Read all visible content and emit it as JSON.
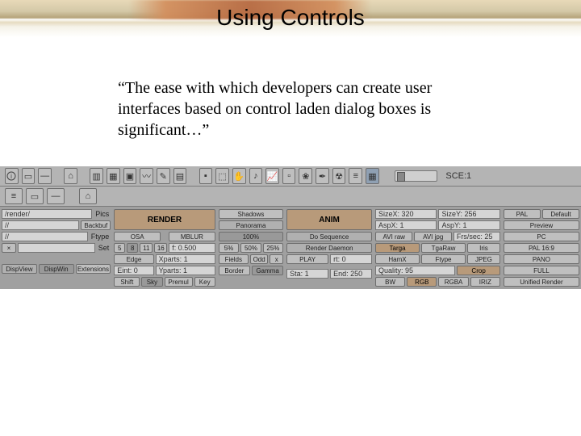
{
  "title": "Using Controls",
  "quote": "“The ease with which developers can create user interfaces based on control laden dialog boxes is significant…”",
  "scene_label": "SCE:1",
  "left_panel": {
    "path_field": "/render/",
    "pics_label": "Pics",
    "backbuf_btn": "Backbuf",
    "ftype_label": "Ftype",
    "set_label": "Set",
    "dispview": "DispView",
    "dispwin": "DispWin",
    "extensions": "Extensions"
  },
  "render_col": {
    "render_btn": "RENDER",
    "osa": "OSA",
    "mblur": "MBLUR",
    "n5": "5",
    "n8": "8",
    "n11": "11",
    "n16": "16",
    "f05": "f: 0.500",
    "edge": "Edge",
    "eint": "Eint: 0",
    "shift": "Shift",
    "sky": "Sky",
    "premul": "Premul",
    "key": "Key",
    "xparts": "Xparts: 1",
    "yparts": "Yparts: 1"
  },
  "mid_col": {
    "shadows": "Shadows",
    "panorama": "Panorama",
    "p100": "100%",
    "p5": "5%",
    "p50": "50%",
    "p25": "25%",
    "fields": "Fields",
    "odd": "Odd",
    "x": "x",
    "border": "Border",
    "gamma": "Gamma"
  },
  "anim_col": {
    "anim_btn": "ANIM",
    "do_seq": "Do Sequence",
    "render_daemon": "Render Daemon",
    "play": "PLAY",
    "rt0": "rt: 0",
    "sta": "Sta: 1",
    "end": "End: 250"
  },
  "size_col": {
    "sizex": "SizeX: 320",
    "sizey": "SizeY: 256",
    "aspx": "AspX: 1",
    "aspy": "AspY: 1",
    "avi_raw": "AVI raw",
    "avi_jpg": "AVI jpg",
    "frs_sec": "Frs/sec: 25",
    "targa": "Targa",
    "tga_raw": "TgaRaw",
    "iris": "Iris",
    "hamx": "HamX",
    "ftype2": "Ftype",
    "jpeg": "JPEG",
    "quality": "Quality: 95",
    "crop": "Crop",
    "bw": "BW",
    "rgb": "RGB",
    "rgba": "RGBA",
    "iriz": "IRIZ"
  },
  "preset_col": {
    "pal": "PAL",
    "default": "Default",
    "preview": "Preview",
    "pc": "PC",
    "pal169": "PAL 16:9",
    "pano": "PANO",
    "full": "FULL",
    "unified": "Unified Render"
  }
}
